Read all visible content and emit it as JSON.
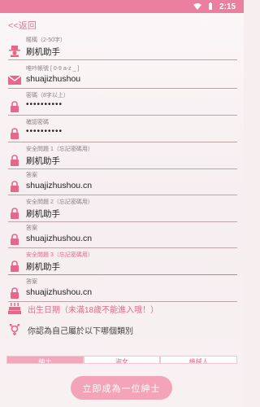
{
  "status": {
    "time": "2:15"
  },
  "nav": {
    "back_label": "<<返回"
  },
  "form": {
    "nickname": {
      "label": "暱稱（2-50字）",
      "value": "刷机助手"
    },
    "account": {
      "label": "唯吟帳號 [ 0-9 a-z _ ]",
      "value": "shuajizhushou"
    },
    "password": {
      "label": "密碼（8字以上）",
      "value": "••••••••••"
    },
    "confirm": {
      "label": "確認密碼",
      "value": "••••••••••"
    },
    "q1": {
      "label": "安全問題 1（忘記密碼用）",
      "value": "刷机助手"
    },
    "a1": {
      "label": "答案",
      "value": "shuajizhushou.cn"
    },
    "q2": {
      "label": "安全問題 2（忘記密碼用）",
      "value": "刷机助手"
    },
    "a2": {
      "label": "答案",
      "value": "shuajizhushou.cn"
    },
    "q3": {
      "label": "安全問題 3（忘記密碼用）",
      "value": "刷机助手"
    },
    "a3": {
      "label": "答案",
      "value": "shuajizhushou.cn"
    }
  },
  "birthday": {
    "label": "出生日期（未滿18歲不能進入哦！）"
  },
  "gender": {
    "prompt": "你認為自己屬於以下哪個類別",
    "options": [
      "紳士",
      "淑女",
      "機械人"
    ],
    "selected": "紳士"
  },
  "submit": {
    "label": "立即成為一位紳士"
  },
  "colors": {
    "accent": "#e8668a",
    "statusbar": "#eb7fa0",
    "button": "#f4a4b8"
  }
}
